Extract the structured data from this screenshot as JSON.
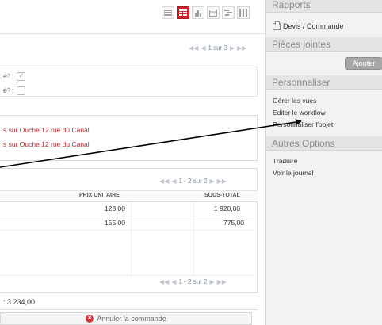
{
  "header": {
    "pager_text": "1 sur 3"
  },
  "fields": [
    {
      "label": "é",
      "marker": "?",
      "checked": true
    },
    {
      "label": "é",
      "marker": "?",
      "checked": false
    }
  ],
  "addresses": [
    "s sur Ouche 12 rue du Canal",
    "s sur Ouche 12 rue du Canal"
  ],
  "lines": {
    "pager_text": "1 - 2 sur 2",
    "headers": {
      "unit_price": "PRIX UNITAIRE",
      "subtotal": "SOUS-TOTAL"
    },
    "rows": [
      {
        "unit_price": "128,00",
        "subtotal": "1 920,00"
      },
      {
        "unit_price": "155,00",
        "subtotal": "775,00"
      }
    ],
    "footer_pager_text": "1 - 2 sur 2"
  },
  "total": ": 3 234,00",
  "cancel_label": "Annuler la commande",
  "sidebar": {
    "reports_title": "Rapports",
    "devis_label": "Devis / Commande",
    "attachments_title": "Pièces jointes",
    "add_label": "Ajouter",
    "customize_title": "Personnaliser",
    "customize_items": [
      "Gérer les vues",
      "Editer le workflow",
      "Personnaliser l'objet"
    ],
    "other_title": "Autres Options",
    "other_items": [
      "Traduire",
      "Voir le journal"
    ]
  },
  "colors": {
    "accent": "#c9262c",
    "address": "#b8282d"
  }
}
